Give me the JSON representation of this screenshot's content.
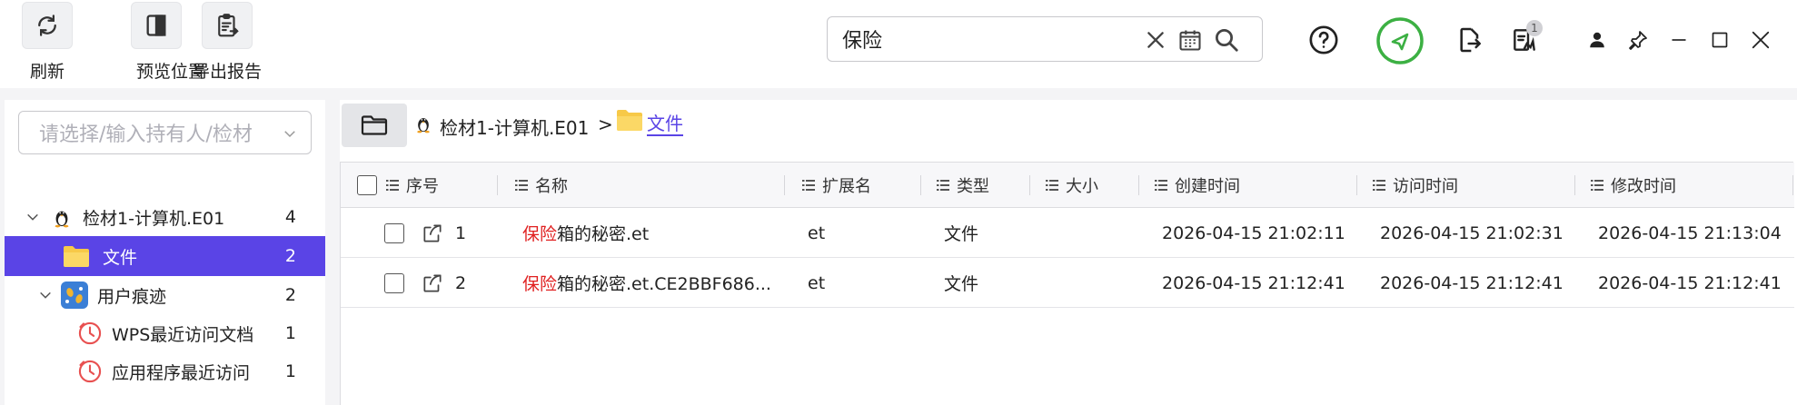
{
  "toolbar": {
    "refresh_label": "刷新",
    "preview_label": "预览位置",
    "export_label": "导出报告"
  },
  "search": {
    "value": "保险"
  },
  "notification_badge": "1",
  "sidebar": {
    "owner_placeholder": "请选择/输入持有人/检材",
    "tree": [
      {
        "label": "检材1-计算机.E01",
        "count": "4",
        "icon": "linux-tux-icon"
      },
      {
        "label": "文件",
        "count": "2",
        "icon": "folder-icon",
        "selected": true
      },
      {
        "label": "用户痕迹",
        "count": "2",
        "icon": "user-trace-icon"
      },
      {
        "label": "WPS最近访问文档",
        "count": "1",
        "icon": "clock-icon"
      },
      {
        "label": "应用程序最近访问",
        "count": "1",
        "icon": "clock-icon"
      }
    ]
  },
  "breadcrumb": {
    "evidence": "检材1-计算机.E01",
    "separator": ">",
    "folder": "文件"
  },
  "table": {
    "headers": {
      "index": "序号",
      "name": "名称",
      "ext": "扩展名",
      "type": "类型",
      "size": "大小",
      "created": "创建时间",
      "accessed": "访问时间",
      "modified": "修改时间"
    },
    "rows": [
      {
        "index": "1",
        "name_hl": "保险",
        "name_rest": "箱的秘密.et",
        "ext": "et",
        "type": "文件",
        "size": "",
        "created": "2026-04-15 21:02:11",
        "accessed": "2026-04-15 21:02:31",
        "modified": "2026-04-15 21:13:04"
      },
      {
        "index": "2",
        "name_hl": "保险",
        "name_rest": "箱的秘密.et.CE2BBF686...",
        "ext": "et",
        "type": "文件",
        "size": "",
        "created": "2026-04-15 21:12:41",
        "accessed": "2026-04-15 21:12:41",
        "modified": "2026-04-15 21:12:41"
      }
    ]
  },
  "colors": {
    "accent": "#5a44e6",
    "highlight": "#e02020",
    "folder": "#f7c948",
    "green": "#3cb043"
  }
}
